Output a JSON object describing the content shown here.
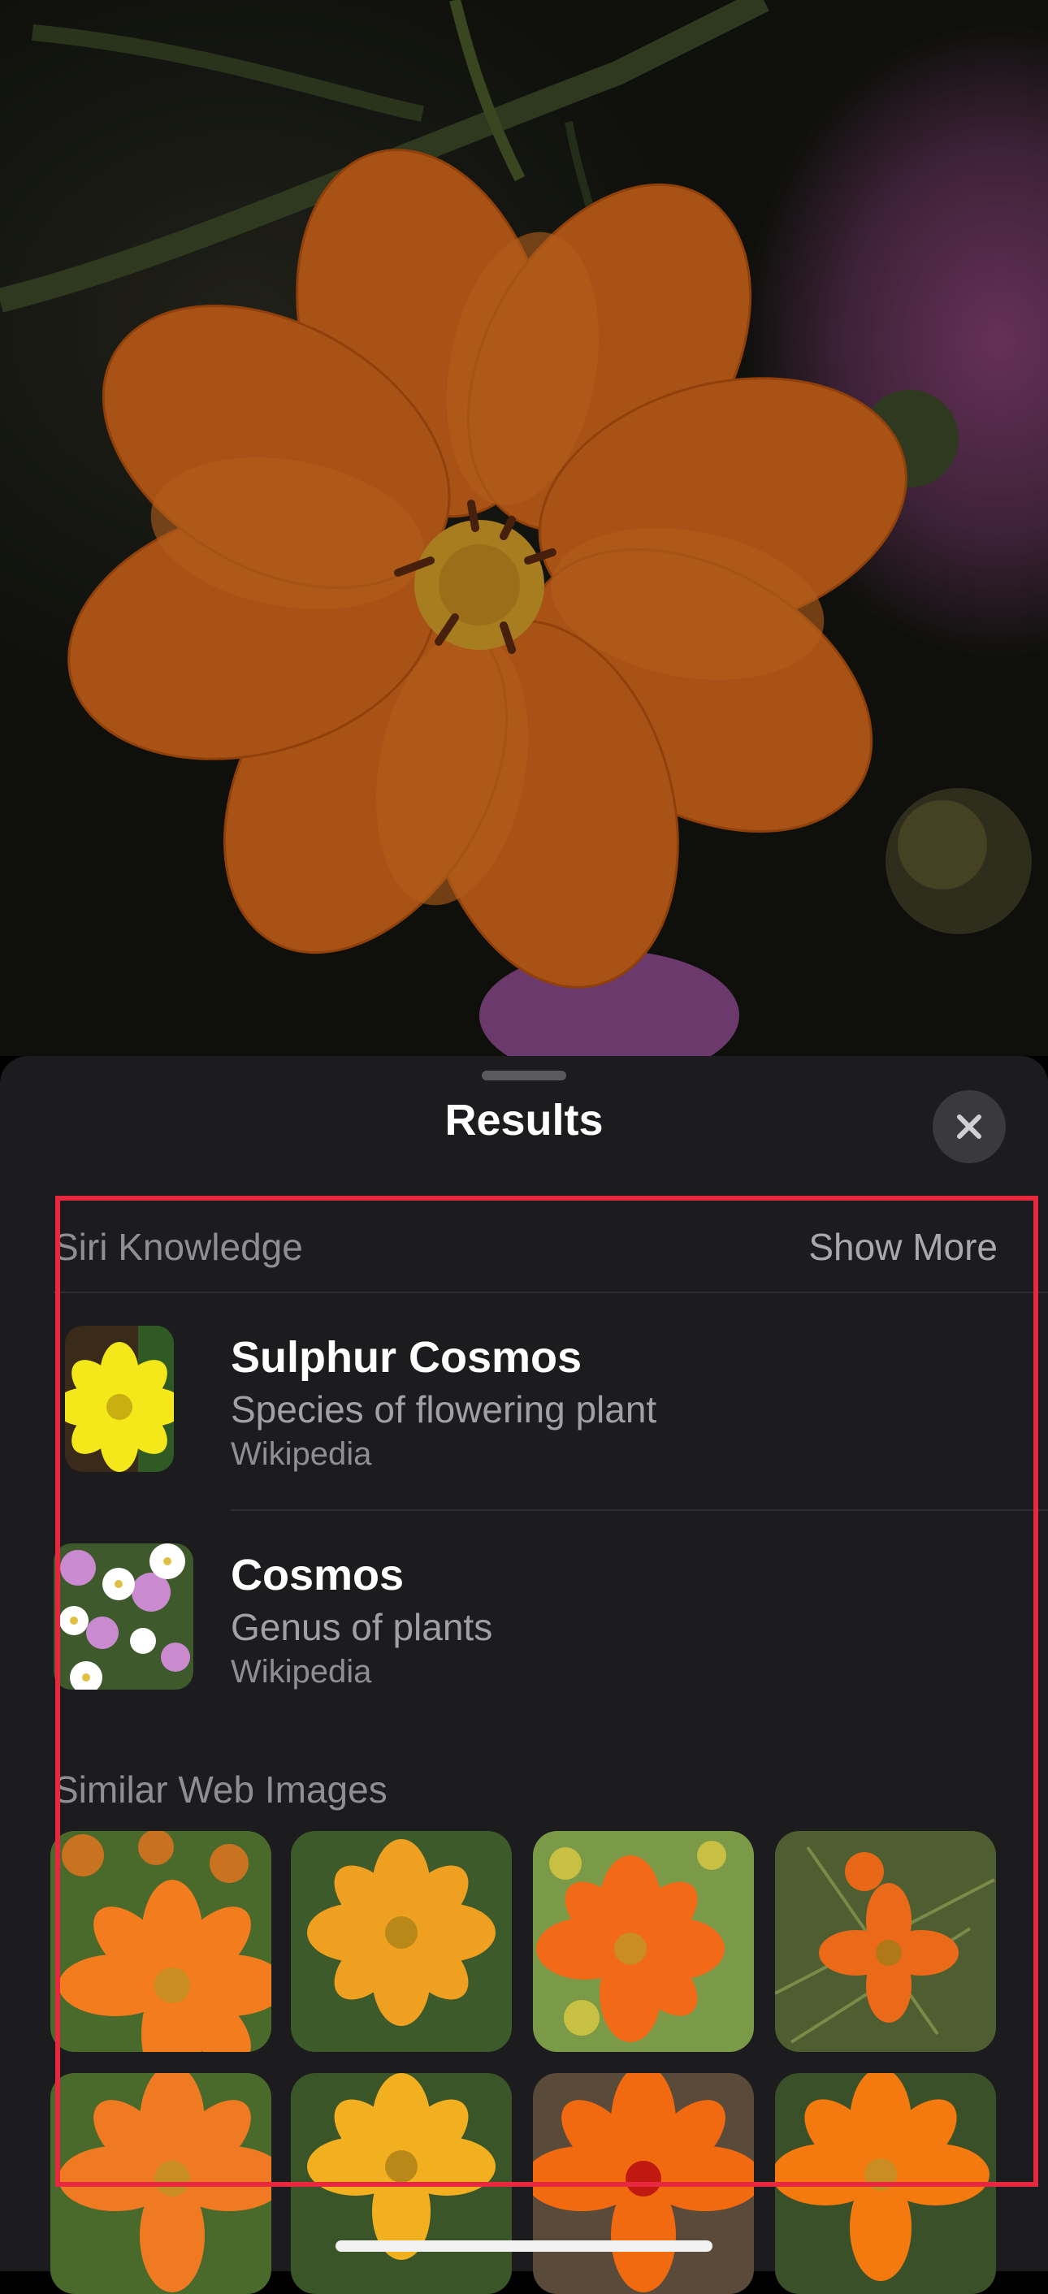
{
  "sheet": {
    "title": "Results",
    "close_icon": "close-icon"
  },
  "siri_knowledge": {
    "header": "Siri Knowledge",
    "show_more": "Show More",
    "results": [
      {
        "title": "Sulphur Cosmos",
        "subtitle": "Species of flowering plant",
        "source": "Wikipedia"
      },
      {
        "title": "Cosmos",
        "subtitle": "Genus of plants",
        "source": "Wikipedia"
      }
    ]
  },
  "similar_web_images": {
    "header": "Similar Web Images"
  },
  "colors": {
    "sheet_background": "#1c1c1e",
    "annotation": "#e8283f",
    "flower_orange": "#e8741e"
  }
}
